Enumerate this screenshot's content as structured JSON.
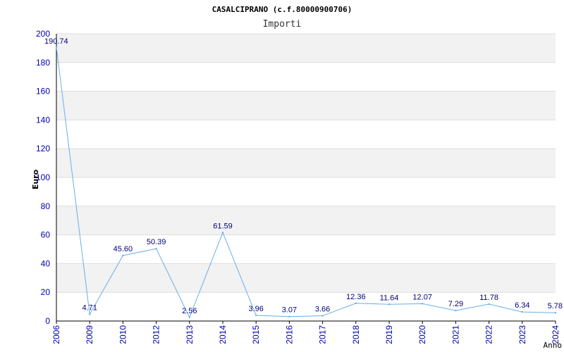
{
  "chart_data": {
    "type": "line",
    "title": "CASALCIPRANO (c.f.80000900706)",
    "subtitle": "Importi",
    "xlabel": "Anno",
    "ylabel": "Euro",
    "ylim": [
      0,
      200
    ],
    "yticks": [
      0,
      20,
      40,
      60,
      80,
      100,
      120,
      140,
      160,
      180,
      200
    ],
    "grid": true,
    "categories": [
      "2006",
      "2009",
      "2010",
      "2012",
      "2013",
      "2014",
      "2015",
      "2016",
      "2017",
      "2018",
      "2019",
      "2020",
      "2021",
      "2022",
      "2023",
      "2024"
    ],
    "values": [
      190.74,
      4.71,
      45.6,
      50.39,
      2.56,
      61.59,
      3.96,
      3.07,
      3.66,
      12.36,
      11.64,
      12.07,
      7.29,
      11.78,
      6.34,
      5.78
    ],
    "value_labels": [
      "190.74",
      "4.71",
      "45.60",
      "50.39",
      "2.56",
      "61.59",
      "3.96",
      "3.07",
      "3.66",
      "12.36",
      "11.64",
      "12.07",
      "7.29",
      "11.78",
      "6.34",
      "5.78"
    ],
    "colors": {
      "line": "#6aaee8",
      "band": "#f2f2f2",
      "gridline": "#dddddd",
      "axis": "#000000",
      "tick_text": "#0000aa",
      "label_text": "#000080"
    }
  }
}
